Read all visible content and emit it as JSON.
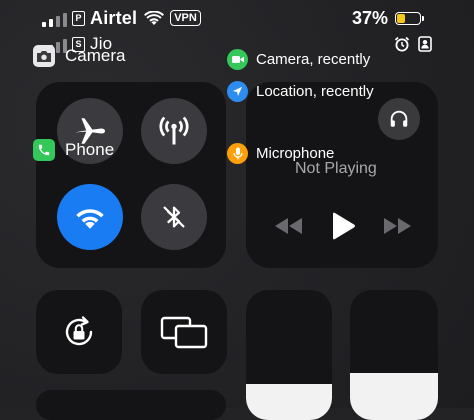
{
  "status_bar": {
    "carrier1": "Airtel",
    "sim1_badge": "P",
    "vpn_label": "VPN",
    "carrier2": "Jio",
    "sim2_badge": "S",
    "battery_percent": "37%",
    "battery_level": 0.37,
    "battery_color": "#f7c919"
  },
  "privacy": {
    "camera_indicator": "Camera, recently",
    "location_indicator": "Location, recently",
    "microphone_indicator": "Microphone"
  },
  "apps": {
    "camera_label": "Camera",
    "phone_label": "Phone"
  },
  "media": {
    "status": "Not Playing"
  },
  "colors": {
    "accent_blue": "#1a7cf3",
    "camera_green": "#34c759",
    "location_blue": "#2d8cf0",
    "mic_orange": "#ff9f0a"
  },
  "icons": {
    "airplane": "airplane-icon",
    "cellular": "cellular-antenna-icon",
    "wifi": "wifi-icon",
    "bluetooth": "bluetooth-icon",
    "rotation_lock": "rotation-lock-icon",
    "screen_mirror": "screen-mirroring-icon",
    "headphones": "headphones-icon",
    "alarm": "alarm-clock-icon",
    "contact": "contact-card-icon"
  },
  "sliders": {
    "brightness_level": 0.28,
    "volume_level": 0.36
  }
}
